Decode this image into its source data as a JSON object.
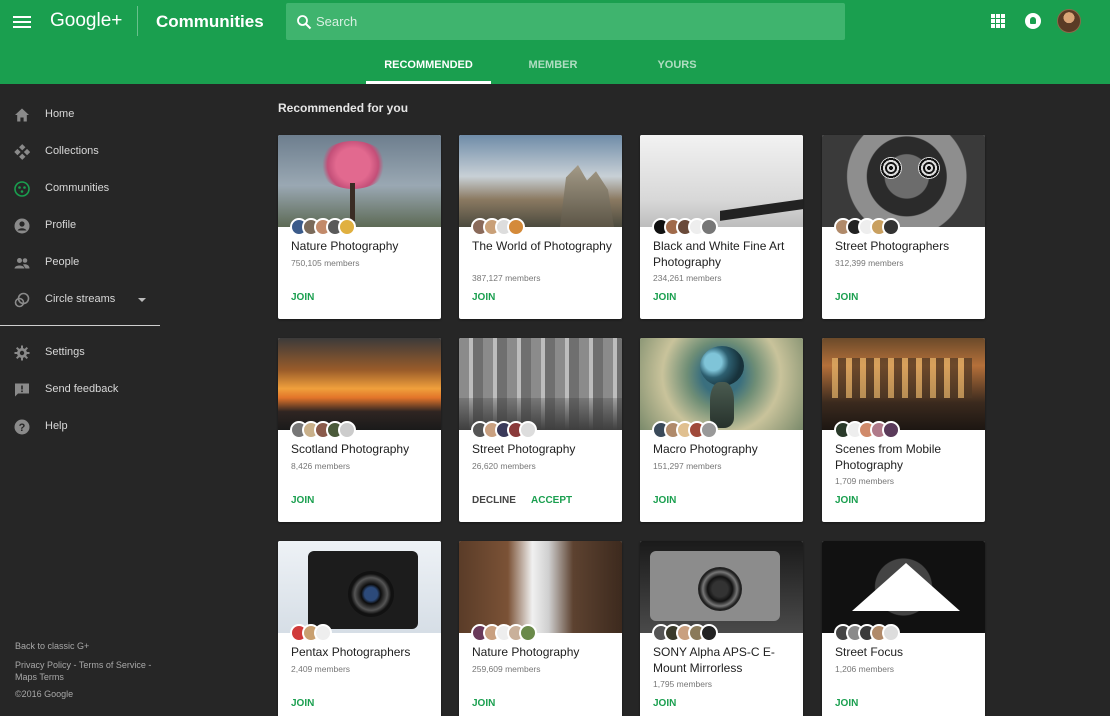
{
  "header": {
    "logo": "Google+",
    "title": "Communities",
    "search_placeholder": "Search",
    "icons": [
      "menu-icon",
      "search-icon",
      "apps-icon",
      "notifications-icon",
      "avatar"
    ]
  },
  "tabs": [
    {
      "label": "RECOMMENDED",
      "active": true
    },
    {
      "label": "MEMBER",
      "active": false
    },
    {
      "label": "YOURS",
      "active": false
    }
  ],
  "sidebar": {
    "items": [
      {
        "label": "Home",
        "icon": "home-icon"
      },
      {
        "label": "Collections",
        "icon": "collections-icon"
      },
      {
        "label": "Communities",
        "icon": "communities-icon",
        "active": true
      },
      {
        "label": "Profile",
        "icon": "profile-icon"
      },
      {
        "label": "People",
        "icon": "people-icon"
      },
      {
        "label": "Circle streams",
        "icon": "circle-streams-icon",
        "expandable": true
      }
    ],
    "secondary": [
      {
        "label": "Settings",
        "icon": "settings-icon"
      },
      {
        "label": "Send feedback",
        "icon": "feedback-icon"
      },
      {
        "label": "Help",
        "icon": "help-icon"
      }
    ],
    "footer": {
      "back_classic": "Back to classic G+",
      "privacy": "Privacy Policy",
      "sep1": " - ",
      "terms": "Terms of Service",
      "sep2": " -",
      "maps": "Maps Terms",
      "copyright": "©2016 Google"
    }
  },
  "main": {
    "section_title": "Recommended for you",
    "communities": [
      {
        "name": "Nature Photography",
        "members": "750,105 members",
        "action": "JOIN"
      },
      {
        "name": "The World of Photography",
        "members": "387,127 members",
        "action": "JOIN"
      },
      {
        "name": "Black and White Fine Art Photography",
        "members": "234,261 members",
        "action": "JOIN"
      },
      {
        "name": "Street Photographers",
        "members": "312,399 members",
        "action": "JOIN"
      },
      {
        "name": "Scotland Photography",
        "members": "8,426 members",
        "action": "JOIN"
      },
      {
        "name": "Street Photography",
        "members": "26,620 members",
        "decline": "DECLINE",
        "accept": "ACCEPT"
      },
      {
        "name": "Macro Photography",
        "members": "151,297 members",
        "action": "JOIN"
      },
      {
        "name": "Scenes from Mobile Photography",
        "members": "1,709 members",
        "action": "JOIN"
      },
      {
        "name": "Pentax Photographers",
        "members": "2,409 members",
        "action": "JOIN"
      },
      {
        "name": "Nature Photography",
        "members": "259,609 members",
        "action": "JOIN"
      },
      {
        "name": "SONY Alpha APS-C E-Mount Mirrorless",
        "members": "1,795 members",
        "action": "JOIN"
      },
      {
        "name": "Street Focus",
        "members": "1,206 members",
        "action": "JOIN"
      }
    ]
  },
  "colors": {
    "brand_green": "#1a9f4f",
    "search_bg": "#3fb46e",
    "page_bg": "#262626",
    "card_bg": "#ffffff"
  }
}
